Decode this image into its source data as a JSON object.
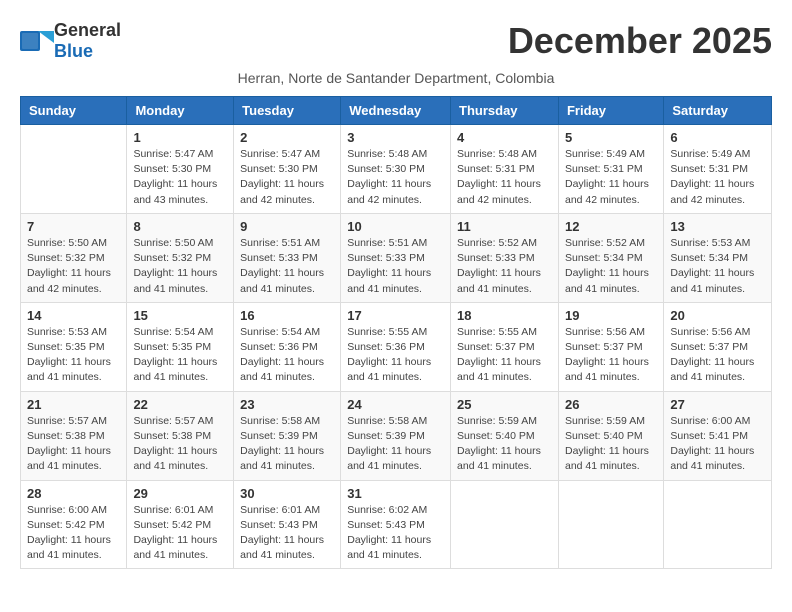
{
  "logo": {
    "general": "General",
    "blue": "Blue"
  },
  "title": "December 2025",
  "subtitle": "Herran, Norte de Santander Department, Colombia",
  "days_of_week": [
    "Sunday",
    "Monday",
    "Tuesday",
    "Wednesday",
    "Thursday",
    "Friday",
    "Saturday"
  ],
  "weeks": [
    [
      {
        "day": "",
        "info": ""
      },
      {
        "day": "1",
        "info": "Sunrise: 5:47 AM\nSunset: 5:30 PM\nDaylight: 11 hours\nand 43 minutes."
      },
      {
        "day": "2",
        "info": "Sunrise: 5:47 AM\nSunset: 5:30 PM\nDaylight: 11 hours\nand 42 minutes."
      },
      {
        "day": "3",
        "info": "Sunrise: 5:48 AM\nSunset: 5:30 PM\nDaylight: 11 hours\nand 42 minutes."
      },
      {
        "day": "4",
        "info": "Sunrise: 5:48 AM\nSunset: 5:31 PM\nDaylight: 11 hours\nand 42 minutes."
      },
      {
        "day": "5",
        "info": "Sunrise: 5:49 AM\nSunset: 5:31 PM\nDaylight: 11 hours\nand 42 minutes."
      },
      {
        "day": "6",
        "info": "Sunrise: 5:49 AM\nSunset: 5:31 PM\nDaylight: 11 hours\nand 42 minutes."
      }
    ],
    [
      {
        "day": "7",
        "info": "Sunrise: 5:50 AM\nSunset: 5:32 PM\nDaylight: 11 hours\nand 42 minutes."
      },
      {
        "day": "8",
        "info": "Sunrise: 5:50 AM\nSunset: 5:32 PM\nDaylight: 11 hours\nand 41 minutes."
      },
      {
        "day": "9",
        "info": "Sunrise: 5:51 AM\nSunset: 5:33 PM\nDaylight: 11 hours\nand 41 minutes."
      },
      {
        "day": "10",
        "info": "Sunrise: 5:51 AM\nSunset: 5:33 PM\nDaylight: 11 hours\nand 41 minutes."
      },
      {
        "day": "11",
        "info": "Sunrise: 5:52 AM\nSunset: 5:33 PM\nDaylight: 11 hours\nand 41 minutes."
      },
      {
        "day": "12",
        "info": "Sunrise: 5:52 AM\nSunset: 5:34 PM\nDaylight: 11 hours\nand 41 minutes."
      },
      {
        "day": "13",
        "info": "Sunrise: 5:53 AM\nSunset: 5:34 PM\nDaylight: 11 hours\nand 41 minutes."
      }
    ],
    [
      {
        "day": "14",
        "info": "Sunrise: 5:53 AM\nSunset: 5:35 PM\nDaylight: 11 hours\nand 41 minutes."
      },
      {
        "day": "15",
        "info": "Sunrise: 5:54 AM\nSunset: 5:35 PM\nDaylight: 11 hours\nand 41 minutes."
      },
      {
        "day": "16",
        "info": "Sunrise: 5:54 AM\nSunset: 5:36 PM\nDaylight: 11 hours\nand 41 minutes."
      },
      {
        "day": "17",
        "info": "Sunrise: 5:55 AM\nSunset: 5:36 PM\nDaylight: 11 hours\nand 41 minutes."
      },
      {
        "day": "18",
        "info": "Sunrise: 5:55 AM\nSunset: 5:37 PM\nDaylight: 11 hours\nand 41 minutes."
      },
      {
        "day": "19",
        "info": "Sunrise: 5:56 AM\nSunset: 5:37 PM\nDaylight: 11 hours\nand 41 minutes."
      },
      {
        "day": "20",
        "info": "Sunrise: 5:56 AM\nSunset: 5:37 PM\nDaylight: 11 hours\nand 41 minutes."
      }
    ],
    [
      {
        "day": "21",
        "info": "Sunrise: 5:57 AM\nSunset: 5:38 PM\nDaylight: 11 hours\nand 41 minutes."
      },
      {
        "day": "22",
        "info": "Sunrise: 5:57 AM\nSunset: 5:38 PM\nDaylight: 11 hours\nand 41 minutes."
      },
      {
        "day": "23",
        "info": "Sunrise: 5:58 AM\nSunset: 5:39 PM\nDaylight: 11 hours\nand 41 minutes."
      },
      {
        "day": "24",
        "info": "Sunrise: 5:58 AM\nSunset: 5:39 PM\nDaylight: 11 hours\nand 41 minutes."
      },
      {
        "day": "25",
        "info": "Sunrise: 5:59 AM\nSunset: 5:40 PM\nDaylight: 11 hours\nand 41 minutes."
      },
      {
        "day": "26",
        "info": "Sunrise: 5:59 AM\nSunset: 5:40 PM\nDaylight: 11 hours\nand 41 minutes."
      },
      {
        "day": "27",
        "info": "Sunrise: 6:00 AM\nSunset: 5:41 PM\nDaylight: 11 hours\nand 41 minutes."
      }
    ],
    [
      {
        "day": "28",
        "info": "Sunrise: 6:00 AM\nSunset: 5:42 PM\nDaylight: 11 hours\nand 41 minutes."
      },
      {
        "day": "29",
        "info": "Sunrise: 6:01 AM\nSunset: 5:42 PM\nDaylight: 11 hours\nand 41 minutes."
      },
      {
        "day": "30",
        "info": "Sunrise: 6:01 AM\nSunset: 5:43 PM\nDaylight: 11 hours\nand 41 minutes."
      },
      {
        "day": "31",
        "info": "Sunrise: 6:02 AM\nSunset: 5:43 PM\nDaylight: 11 hours\nand 41 minutes."
      },
      {
        "day": "",
        "info": ""
      },
      {
        "day": "",
        "info": ""
      },
      {
        "day": "",
        "info": ""
      }
    ]
  ]
}
